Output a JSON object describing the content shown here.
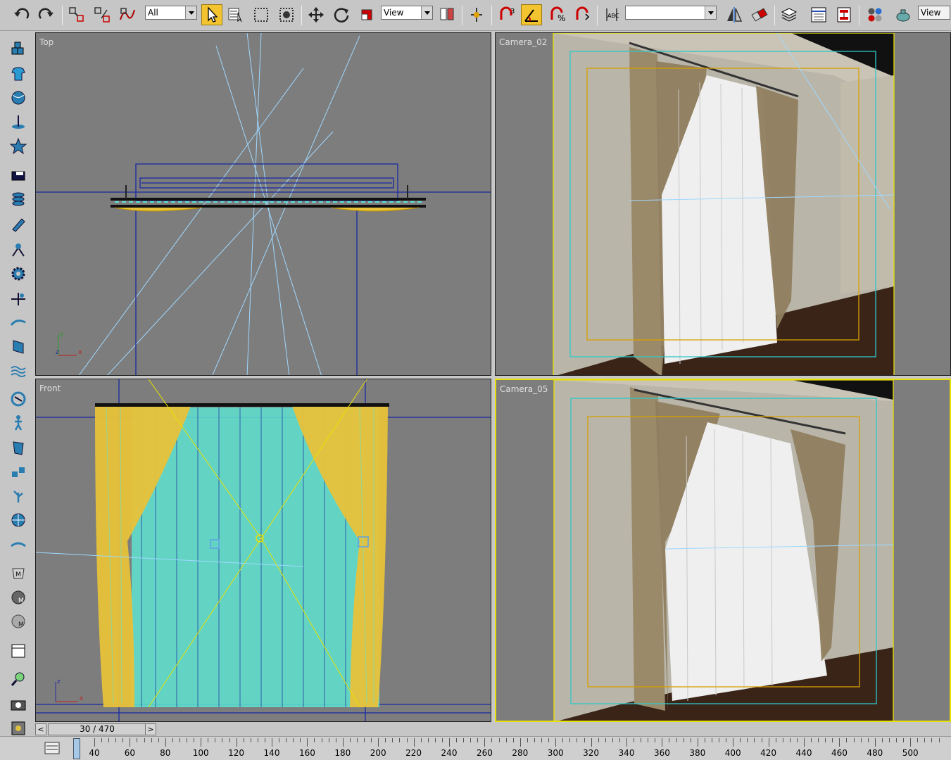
{
  "toolbar": {
    "selection_filter": "All",
    "ref_coord_system": "View",
    "named_selection_placeholder": "",
    "right_view_label": "View",
    "snap_badge": "3",
    "icons": [
      "undo-icon",
      "redo-icon",
      "select-and-link-icon",
      "unlink-selection-icon",
      "bind-to-space-warp-icon",
      "select-object-icon",
      "select-by-name-icon",
      "rectangular-selection-region-icon",
      "window-crossing-icon",
      "select-and-move-icon",
      "select-and-rotate-icon",
      "select-and-scale-icon",
      "use-pivot-center-icon",
      "select-and-manipulate-icon",
      "snaps-toggle-icon",
      "angle-snap-toggle-icon",
      "percent-snap-toggle-icon",
      "spinner-snap-toggle-icon",
      "edit-named-selection-sets-icon",
      "mirror-icon",
      "align-icon",
      "layer-manager-icon",
      "curve-editor-icon",
      "schematic-view-icon",
      "material-editor-icon",
      "render-setup-icon"
    ]
  },
  "viewports": {
    "top": {
      "label": "Top"
    },
    "camera02": {
      "label": "Camera_02"
    },
    "front": {
      "label": "Front"
    },
    "camera05": {
      "label": "Camera_05"
    }
  },
  "axis_labels": {
    "x": "x",
    "y": "y",
    "z": "z"
  },
  "timeslider": {
    "frame_display": "30 / 470",
    "prev_label": "<",
    "next_label": ">"
  },
  "trackbar": {
    "tick_labels": [
      "40",
      "60",
      "80",
      "100",
      "120",
      "140",
      "160",
      "180",
      "200",
      "220",
      "240",
      "260",
      "280",
      "300",
      "320",
      "340",
      "360",
      "380",
      "400",
      "420",
      "440",
      "460",
      "480",
      "500"
    ]
  },
  "colors": {
    "viewport_bg": "#7d7d7d",
    "active_border": "#e8e000",
    "wireframe_blue": "#1a2aa0",
    "wireframe_cyan": "#5ee3d0",
    "wireframe_yellow": "#e8c23a",
    "camera_line": "#9fd8ff",
    "safe_frame_cyan": "#2ec8c8",
    "safe_frame_orange": "#d8a000"
  }
}
